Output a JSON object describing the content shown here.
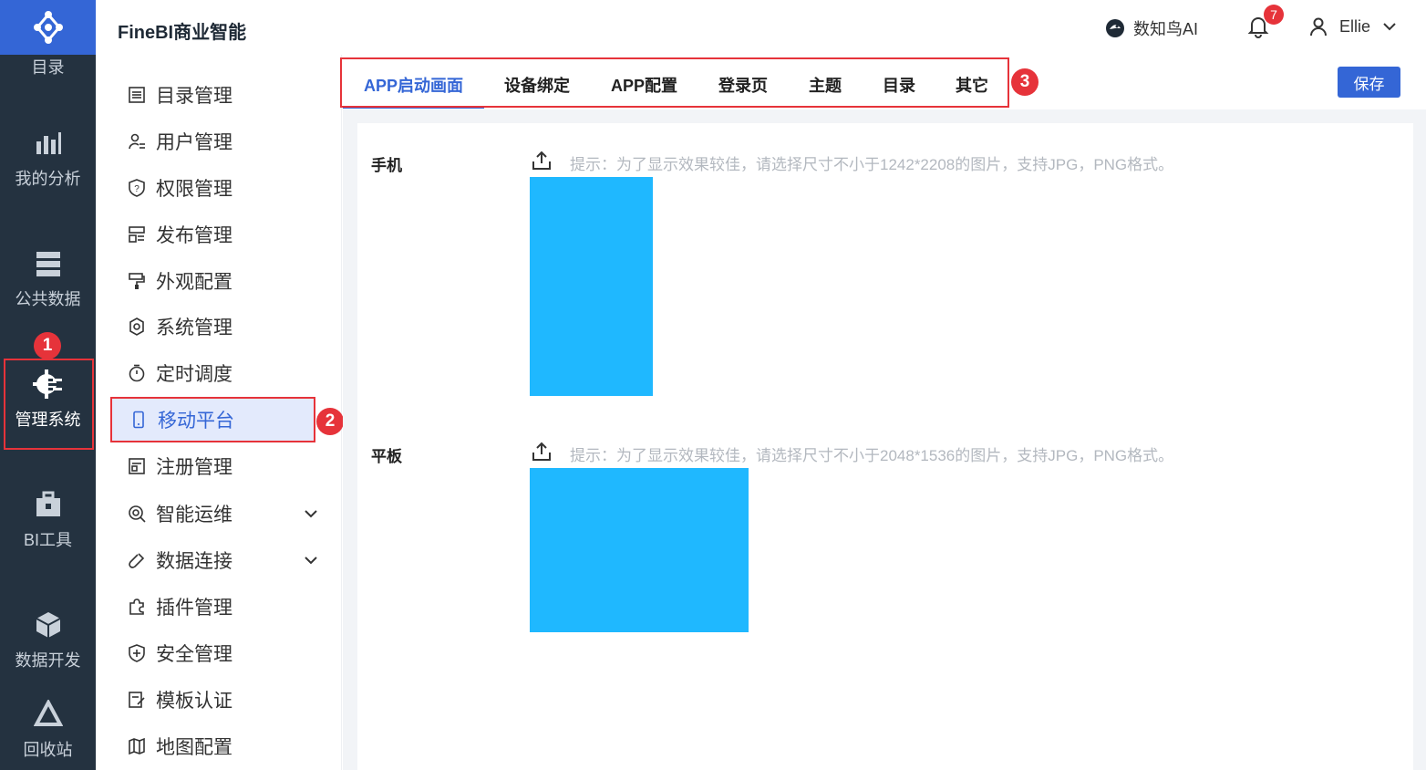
{
  "app": {
    "brand": "FineBI商业智能"
  },
  "rail": {
    "items": [
      {
        "label": "目录",
        "icon": "catalog-icon"
      },
      {
        "label": "我的分析",
        "icon": "analysis-icon"
      },
      {
        "label": "公共数据",
        "icon": "public-data-icon"
      },
      {
        "label": "管理系统",
        "icon": "admin-gear-icon",
        "active": true
      },
      {
        "label": "BI工具",
        "icon": "toolbox-icon"
      },
      {
        "label": "数据开发",
        "icon": "cube-icon"
      },
      {
        "label": "回收站",
        "icon": "recycle-icon"
      }
    ]
  },
  "header": {
    "ai_label": "数知鸟AI",
    "notification_count": "7",
    "user_name": "Ellie"
  },
  "menu": {
    "items": [
      {
        "label": "目录管理",
        "icon": "list-icon"
      },
      {
        "label": "用户管理",
        "icon": "user-list-icon"
      },
      {
        "label": "权限管理",
        "icon": "shield-icon"
      },
      {
        "label": "发布管理",
        "icon": "publish-icon"
      },
      {
        "label": "外观配置",
        "icon": "paint-roller-icon"
      },
      {
        "label": "系统管理",
        "icon": "gear-icon"
      },
      {
        "label": "定时调度",
        "icon": "stopwatch-icon"
      },
      {
        "label": "移动平台",
        "icon": "mobile-icon",
        "active": true
      },
      {
        "label": "注册管理",
        "icon": "register-icon"
      },
      {
        "label": "智能运维",
        "icon": "ops-icon",
        "expandable": true
      },
      {
        "label": "数据连接",
        "icon": "link-icon",
        "expandable": true
      },
      {
        "label": "插件管理",
        "icon": "puzzle-icon"
      },
      {
        "label": "安全管理",
        "icon": "shield-plus-icon"
      },
      {
        "label": "模板认证",
        "icon": "certify-icon"
      },
      {
        "label": "地图配置",
        "icon": "map-icon"
      }
    ]
  },
  "tabs": [
    {
      "label": "APP启动画面",
      "active": true
    },
    {
      "label": "设备绑定"
    },
    {
      "label": "APP配置"
    },
    {
      "label": "登录页"
    },
    {
      "label": "主题"
    },
    {
      "label": "目录"
    },
    {
      "label": "其它"
    }
  ],
  "save_label": "保存",
  "content": {
    "phone": {
      "label": "手机",
      "hint": "提示：为了显示效果较佳，请选择尺寸不小于1242*2208的图片，支持JPG，PNG格式。"
    },
    "tablet": {
      "label": "平板",
      "hint": "提示：为了显示效果较佳，请选择尺寸不小于2048*1536的图片，支持JPG，PNG格式。"
    }
  },
  "annotations": {
    "one": "1",
    "two": "2",
    "three": "3"
  },
  "colors": {
    "accent": "#3466d6",
    "rail": "#243240",
    "preview": "#1fb8ff",
    "highlight": "#e6333a"
  }
}
